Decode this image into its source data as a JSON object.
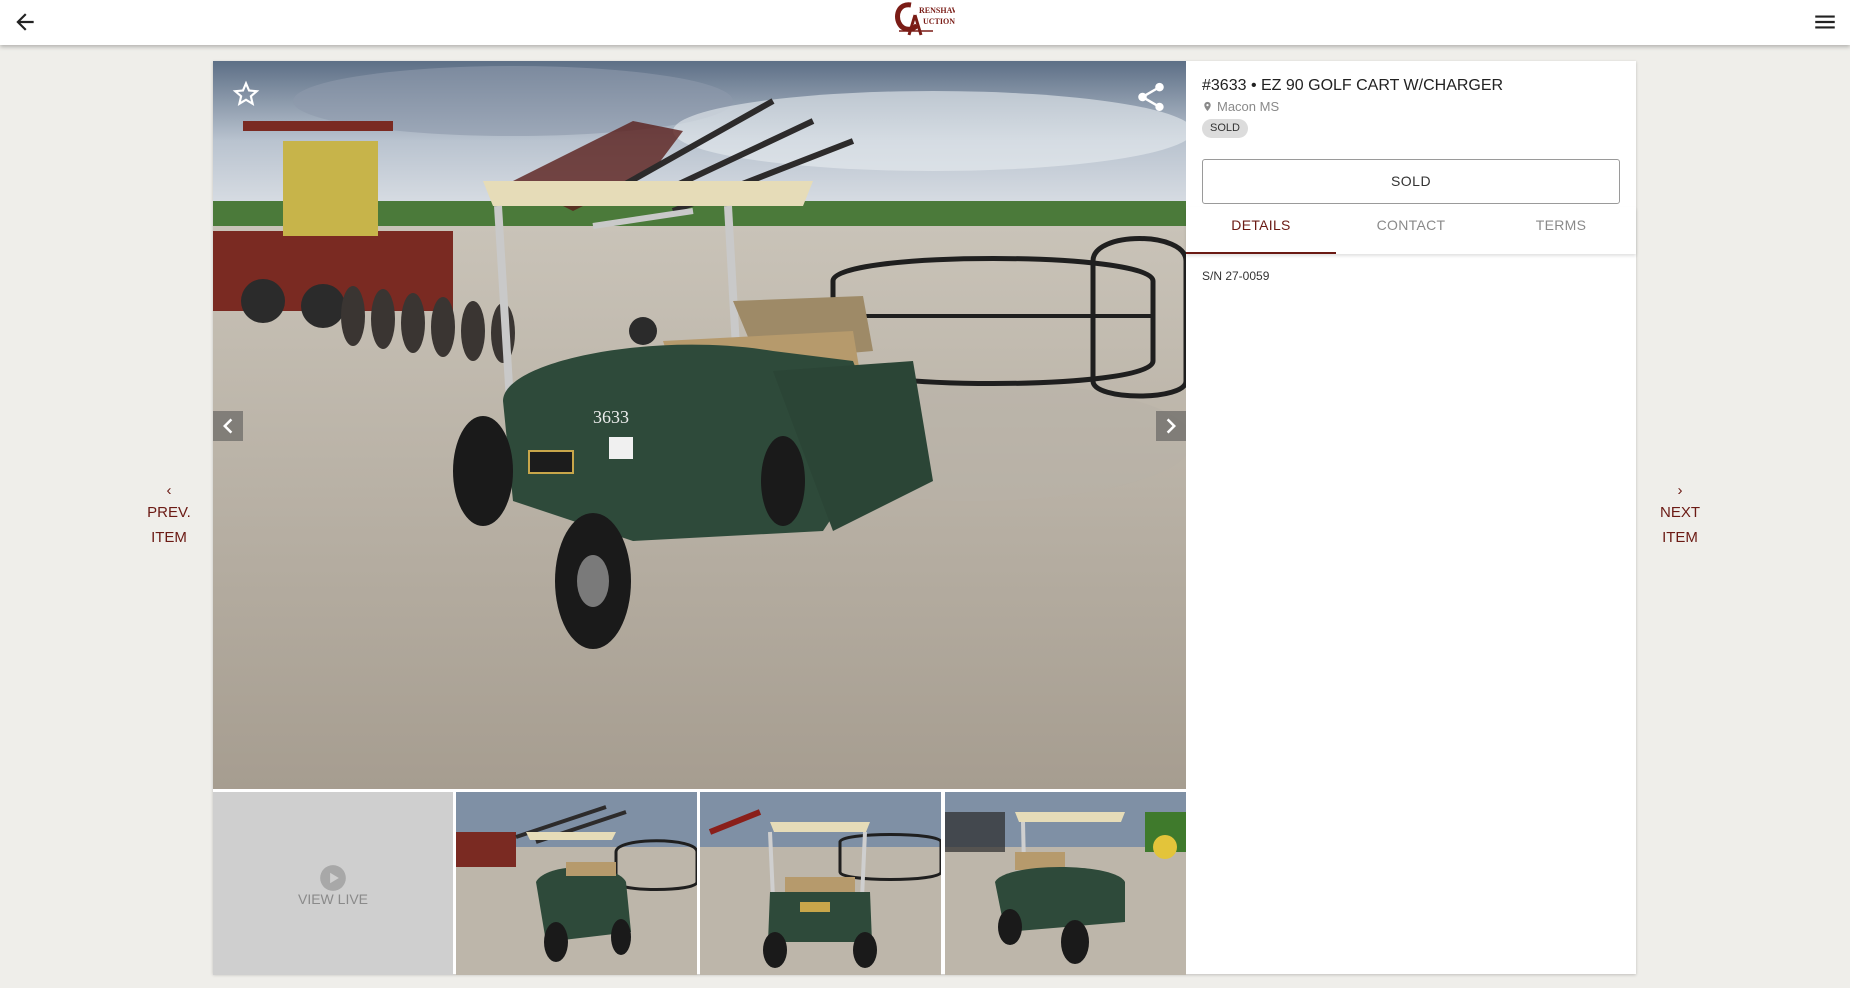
{
  "header": {
    "back_icon": "arrow-left-icon",
    "menu_icon": "hamburger-menu-icon",
    "logo_lines": [
      "RENSHAW",
      "UCTION"
    ],
    "brand_color": "#7a1c16"
  },
  "nav": {
    "prev_label_1": "PREV.",
    "prev_label_2": "ITEM",
    "next_label_1": "NEXT",
    "next_label_2": "ITEM"
  },
  "gallery": {
    "main_photo_text": "3633",
    "view_live_label": "VIEW LIVE",
    "thumbnail_count": 3
  },
  "item": {
    "title": "#3633 • EZ 90 GOLF CART W/CHARGER",
    "location": "Macon MS",
    "status_badge": "SOLD",
    "status_button": "SOLD"
  },
  "tabs": [
    {
      "label": "DETAILS",
      "active": true
    },
    {
      "label": "CONTACT",
      "active": false
    },
    {
      "label": "TERMS",
      "active": false
    }
  ],
  "details": {
    "serial": "S/N 27-0059"
  },
  "colors": {
    "accent": "#6b1a14",
    "background": "#efeeea",
    "badge": "#dcdcdc"
  }
}
